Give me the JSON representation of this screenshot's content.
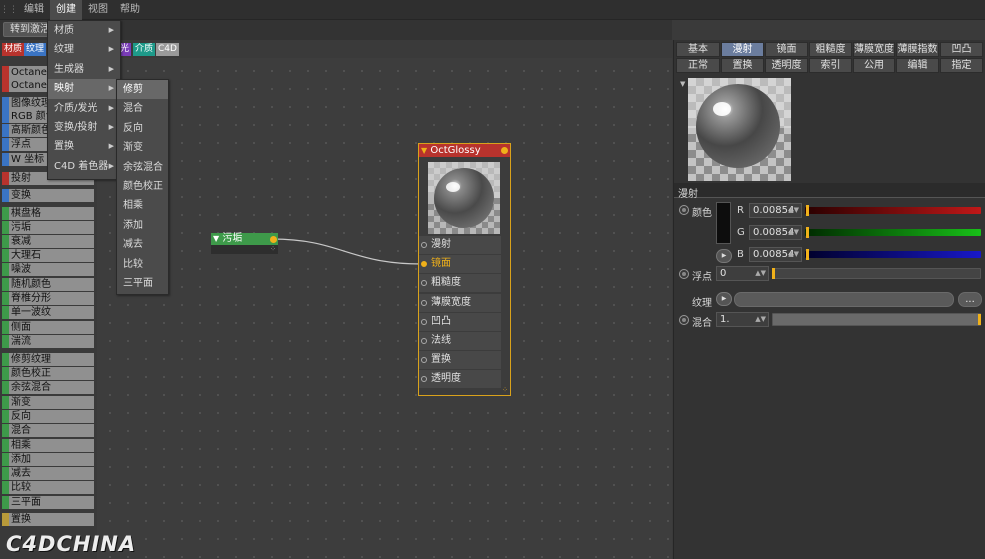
{
  "menubar": {
    "items": [
      "编辑",
      "创建",
      "视图",
      "帮助"
    ],
    "active_index": 1
  },
  "toolbar": {
    "convert_label": "转到激活"
  },
  "tags": [
    {
      "label": "材质",
      "color": "#b8332d"
    },
    {
      "label": "纹理",
      "color": "#3a74c4"
    },
    {
      "label": "光",
      "color": "#7a3db8"
    },
    {
      "label": "介质",
      "color": "#1e9a8a"
    },
    {
      "label": "C4D",
      "color": "#9a9a9a"
    }
  ],
  "left_list": [
    {
      "label": "Octane",
      "color": "#b8332d"
    },
    {
      "label": "Octane",
      "color": "#b8332d"
    },
    {
      "label": "图像纹理",
      "color": "#3a74c4"
    },
    {
      "label": "RGB 颜色",
      "color": "#3a74c4"
    },
    {
      "label": "高斯颜色",
      "color": "#3a74c4"
    },
    {
      "label": "浮点",
      "color": "#3a74c4"
    },
    {
      "label": "W 坐标",
      "color": "#3a74c4"
    },
    {
      "label": "投射",
      "color": "#b8332d"
    },
    {
      "label": "变换",
      "color": "#3a74c4"
    },
    {
      "label": "棋盘格",
      "color": "#3e9a4a"
    },
    {
      "label": "污垢",
      "color": "#3e9a4a"
    },
    {
      "label": "衰减",
      "color": "#3e9a4a"
    },
    {
      "label": "大理石",
      "color": "#3e9a4a"
    },
    {
      "label": "噪波",
      "color": "#3e9a4a"
    },
    {
      "label": "随机颜色",
      "color": "#3e9a4a"
    },
    {
      "label": "脊椎分形",
      "color": "#3e9a4a"
    },
    {
      "label": "单一波纹",
      "color": "#3e9a4a"
    },
    {
      "label": "侧面",
      "color": "#3e9a4a"
    },
    {
      "label": "湍流",
      "color": "#3e9a4a"
    },
    {
      "label": "修剪纹理",
      "color": "#3e9a4a"
    },
    {
      "label": "颜色校正",
      "color": "#3e9a4a"
    },
    {
      "label": "余弦混合",
      "color": "#3e9a4a"
    },
    {
      "label": "渐变",
      "color": "#3e9a4a"
    },
    {
      "label": "反向",
      "color": "#3e9a4a"
    },
    {
      "label": "混合",
      "color": "#3e9a4a"
    },
    {
      "label": "相乘",
      "color": "#3e9a4a"
    },
    {
      "label": "添加",
      "color": "#3e9a4a"
    },
    {
      "label": "减去",
      "color": "#3e9a4a"
    },
    {
      "label": "比较",
      "color": "#3e9a4a"
    },
    {
      "label": "三平面",
      "color": "#3e9a4a"
    },
    {
      "label": "置换",
      "color": "#b89a3a"
    }
  ],
  "create_menu": [
    {
      "label": "材质",
      "arrow": true
    },
    {
      "label": "纹理",
      "arrow": true
    },
    {
      "label": "生成器",
      "arrow": true
    },
    {
      "label": "映射",
      "arrow": true
    },
    {
      "label": "介质/发光",
      "arrow": true
    },
    {
      "label": "变换/投射",
      "arrow": true
    },
    {
      "label": "置换",
      "arrow": true
    },
    {
      "label": "C4D 着色器",
      "arrow": true
    }
  ],
  "create_menu_highlight": 3,
  "mapping_submenu": [
    "修剪",
    "混合",
    "反向",
    "渐变",
    "余弦混合",
    "颜色校正",
    "相乘",
    "添加",
    "减去",
    "比较",
    "三平面"
  ],
  "mapping_submenu_highlight": 0,
  "node_dirt": {
    "title": "污垢"
  },
  "node_octglossy": {
    "title": "OctGlossy",
    "ports": [
      "漫射",
      "镜面",
      "粗糙度",
      "薄膜宽度",
      "凹凸",
      "法线",
      "置换",
      "透明度"
    ],
    "active_port": 1
  },
  "right_panel": {
    "tabs_row1": [
      "基本",
      "漫射",
      "镜面",
      "粗糙度",
      "薄膜宽度",
      "薄膜指数",
      "凹凸"
    ],
    "tabs_row2": [
      "正常",
      "置换",
      "透明度",
      "索引",
      "公用",
      "编辑",
      "指定"
    ],
    "selected_tab": 1,
    "section_title": "漫射",
    "color_label": "颜色",
    "r_label": "R",
    "r_value": "0.00854",
    "g_label": "G",
    "g_value": "0.00854",
    "b_label": "B",
    "b_value": "0.00854",
    "float_label": "浮点",
    "float_value": "0",
    "texture_label": "纹理",
    "texture_button": "...",
    "mix_label": "混合",
    "mix_value": "1."
  },
  "watermark": "C4DCHINA",
  "colors": {
    "accent_orange": "#f0b11a",
    "material_red": "#b8332d",
    "texture_green": "#3e9a4a",
    "tab_selected": "#6b7d9e"
  }
}
